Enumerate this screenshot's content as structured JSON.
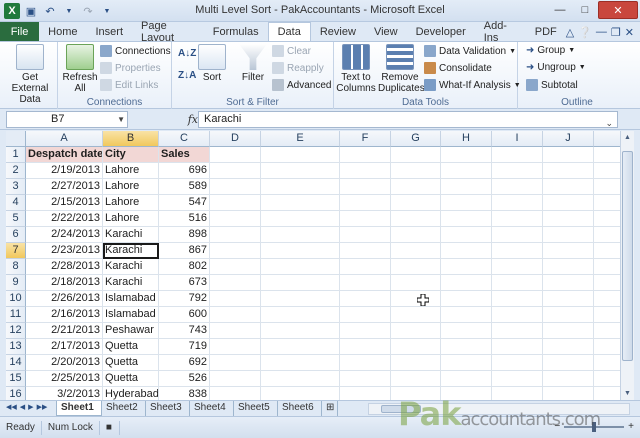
{
  "window": {
    "title": "Multi Level Sort - PakAccountants - Microsoft Excel",
    "app_letter": "X"
  },
  "ribbon_tabs": [
    "File",
    "Home",
    "Insert",
    "Page Layout",
    "Formulas",
    "Data",
    "Review",
    "View",
    "Developer",
    "Add-Ins",
    "PDF"
  ],
  "active_tab": "Data",
  "ribbon": {
    "get_external_data": "Get External Data",
    "refresh_all": "Refresh All",
    "connections": "Connections",
    "properties": "Properties",
    "edit_links": "Edit Links",
    "connections_group": "Connections",
    "sort_az": "A↓Z",
    "sort_za": "Z↓A",
    "sort": "Sort",
    "filter": "Filter",
    "clear": "Clear",
    "reapply": "Reapply",
    "advanced": "Advanced",
    "sort_filter_group": "Sort & Filter",
    "text_to_columns": "Text to Columns",
    "remove_duplicates": "Remove Duplicates",
    "data_validation": "Data Validation",
    "consolidate": "Consolidate",
    "what_if": "What-If Analysis",
    "data_tools_group": "Data Tools",
    "group": "Group",
    "ungroup": "Ungroup",
    "subtotal": "Subtotal",
    "outline_group": "Outline"
  },
  "formula_bar": {
    "name_box": "B7",
    "fx": "fx",
    "value": "Karachi"
  },
  "columns": [
    "A",
    "B",
    "C",
    "D",
    "E",
    "F",
    "G",
    "H",
    "I",
    "J"
  ],
  "selected_column": "B",
  "selected_row": "7",
  "headers": [
    "Despatch date",
    "City",
    "Sales"
  ],
  "rows": [
    [
      "2/19/2013",
      "Lahore",
      "696"
    ],
    [
      "2/27/2013",
      "Lahore",
      "589"
    ],
    [
      "2/15/2013",
      "Lahore",
      "547"
    ],
    [
      "2/22/2013",
      "Lahore",
      "516"
    ],
    [
      "2/24/2013",
      "Karachi",
      "898"
    ],
    [
      "2/23/2013",
      "Karachi",
      "867"
    ],
    [
      "2/28/2013",
      "Karachi",
      "802"
    ],
    [
      "2/18/2013",
      "Karachi",
      "673"
    ],
    [
      "2/26/2013",
      "Islamabad",
      "792"
    ],
    [
      "2/16/2013",
      "Islamabad",
      "600"
    ],
    [
      "2/21/2013",
      "Peshawar",
      "743"
    ],
    [
      "2/17/2013",
      "Quetta",
      "719"
    ],
    [
      "2/20/2013",
      "Quetta",
      "692"
    ],
    [
      "2/25/2013",
      "Quetta",
      "526"
    ],
    [
      "3/2/2013",
      "Hyderabad",
      "838"
    ]
  ],
  "row_numbers": [
    "1",
    "2",
    "3",
    "4",
    "5",
    "6",
    "7",
    "8",
    "9",
    "10",
    "11",
    "12",
    "13",
    "14",
    "15",
    "16"
  ],
  "sheets": [
    "Sheet1",
    "Sheet2",
    "Sheet3",
    "Sheet4",
    "Sheet5",
    "Sheet6"
  ],
  "active_sheet": "Sheet1",
  "status": {
    "mode": "Ready",
    "num_lock": "Num Lock"
  },
  "watermark": {
    "brand": "Pak",
    "rest": "accountants.com"
  },
  "colors": {
    "header_fill": "#f2d7d5",
    "file_tab": "#2a6c3e",
    "selection": "#f1c85d"
  }
}
